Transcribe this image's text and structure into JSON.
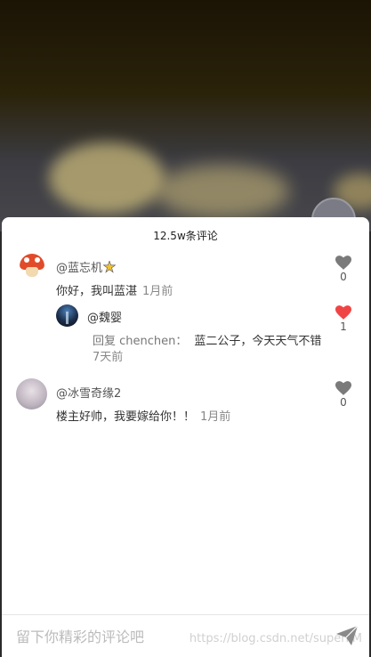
{
  "sheet": {
    "title": "12.5w条评论"
  },
  "comments": [
    {
      "name": "@蓝忘机",
      "text": "你好，我叫蓝湛",
      "time": "1月前",
      "likes": "0",
      "liked": false,
      "replies": [
        {
          "name": "@魏婴",
          "reply_label": "回复 chenchen：",
          "text": "蓝二公子，今天天气不错",
          "time": "7天前",
          "likes": "1",
          "liked": true
        }
      ]
    },
    {
      "name": "@冰雪奇缘2",
      "text": "楼主好帅，我要嫁给你！！",
      "time": "1月前",
      "likes": "0",
      "liked": false
    }
  ],
  "input": {
    "placeholder": "留下你精彩的评论吧"
  },
  "watermark": "https://blog.csdn.net/superliM",
  "colors": {
    "liked": "#f04444",
    "unliked": "#7a7a7a",
    "sheet_bg": "#ffffff"
  },
  "icons": {
    "like": "heart-icon",
    "send": "paper-plane-icon"
  }
}
